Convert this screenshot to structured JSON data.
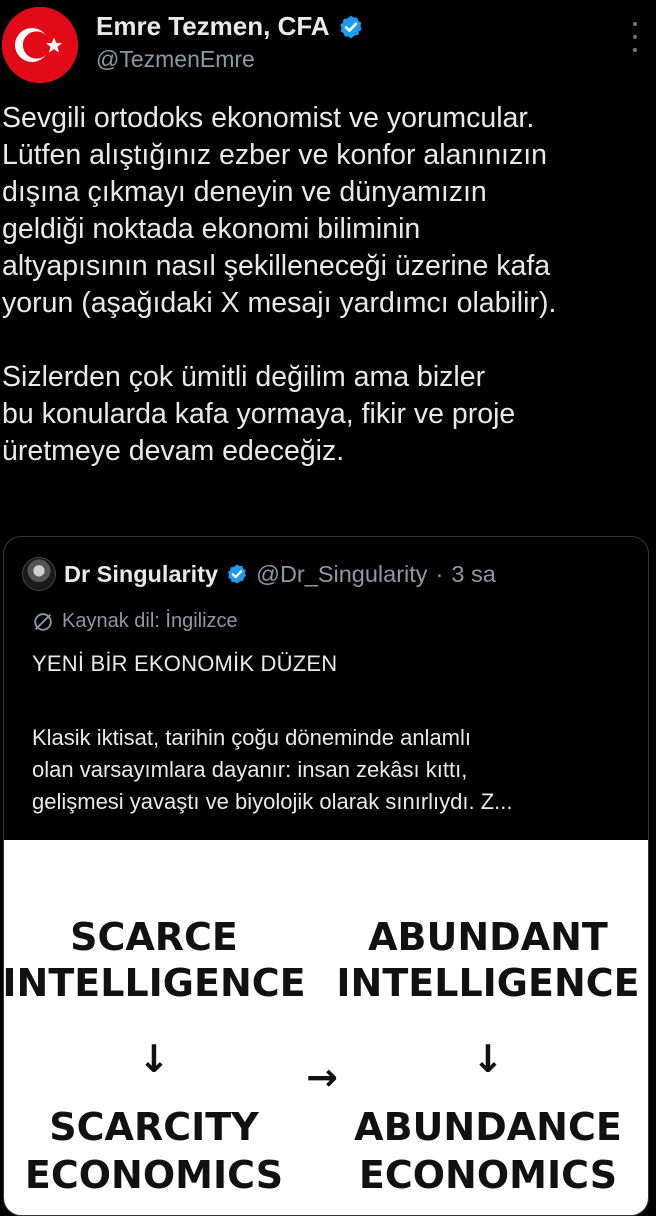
{
  "author": {
    "name": "Emre Tezmen, CFA",
    "handle": "@TezmenEmre",
    "avatar_icon": "turkish-flag-icon",
    "verified_icon": "verified-badge-icon",
    "more_icon": "more-options-icon"
  },
  "tweet": {
    "paragraphs": [
      "Sevgili ortodoks ekonomist ve yorumcular.\nLütfen alıştığınız ezber ve konfor alanınızın\ndışına çıkmayı deneyin ve dünyamızın\ngeldiği noktada ekonomi biliminin\naltyapısının nasıl şekilleneceği üzerine kafa\nyorun (aşağıdaki X mesajı yardımcı olabilir).",
      "Sizlerden çok ümitli değilim ama bizler\nbu konularda kafa yormaya, fikir ve proje\nüretmeye devam edeceğiz."
    ]
  },
  "quote": {
    "name": "Dr Singularity",
    "handle": "@Dr_Singularity",
    "separator": "·",
    "time": "3 sa",
    "source_label": "Kaynak dil: İngilizce",
    "title": "YENİ BİR EKONOMİK DÜZEN",
    "text": "Klasik iktisat, tarihin çoğu döneminde anlamlı\nolan varsayımlara dayanır: insan zekâsı kıttı,\ngelişmesi yavaştı ve biyolojik olarak sınırlıydı. Z...",
    "image": {
      "left_top_line1": "SCARCE",
      "left_top_line2": "INTELLIGENCE",
      "left_bottom_line1": "SCARCITY",
      "left_bottom_line2": "ECONOMICS",
      "right_top_line1": "ABUNDANT",
      "right_top_line2": "INTELLIGENCE",
      "right_bottom_line1": "ABUNDANCE",
      "right_bottom_line2": "ECONOMICS",
      "down_arrow": "↓",
      "right_arrow": "→"
    }
  },
  "colors": {
    "background": "#000000",
    "text_primary": "#e7e9ea",
    "text_secondary": "#8b98a5",
    "verified_blue": "#1d9bf0",
    "flag_red": "#e30a17",
    "card_border": "#333639"
  }
}
